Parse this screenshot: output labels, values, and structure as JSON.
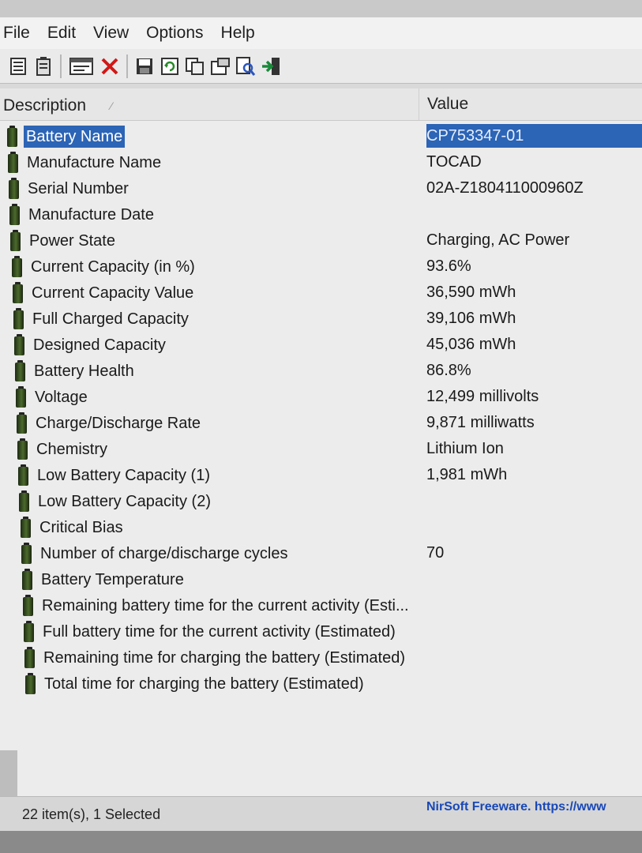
{
  "menu": [
    "File",
    "Edit",
    "View",
    "Options",
    "Help"
  ],
  "toolbar_icons": [
    "html-report-icon",
    "save-icon-small",
    "properties-icon",
    "delete-icon",
    "save-icon",
    "refresh-icon",
    "copy-icon",
    "properties-icon-2",
    "find-icon",
    "exit-icon"
  ],
  "columns": {
    "description": "Description",
    "value": "Value"
  },
  "rows": [
    {
      "description": "Battery Name",
      "value": "CP753347-01",
      "selected": true
    },
    {
      "description": "Manufacture Name",
      "value": "TOCAD"
    },
    {
      "description": "Serial Number",
      "value": "02A-Z180411000960Z"
    },
    {
      "description": "Manufacture Date",
      "value": ""
    },
    {
      "description": "Power State",
      "value": "Charging, AC Power"
    },
    {
      "description": "Current Capacity (in %)",
      "value": "93.6%"
    },
    {
      "description": "Current Capacity Value",
      "value": "36,590 mWh"
    },
    {
      "description": "Full Charged Capacity",
      "value": "39,106 mWh"
    },
    {
      "description": "Designed Capacity",
      "value": "45,036 mWh"
    },
    {
      "description": "Battery Health",
      "value": "86.8%"
    },
    {
      "description": "Voltage",
      "value": "12,499 millivolts"
    },
    {
      "description": "Charge/Discharge Rate",
      "value": "9,871 milliwatts"
    },
    {
      "description": "Chemistry",
      "value": "Lithium Ion"
    },
    {
      "description": "Low Battery Capacity (1)",
      "value": "1,981 mWh"
    },
    {
      "description": "Low Battery Capacity (2)",
      "value": ""
    },
    {
      "description": "Critical Bias",
      "value": ""
    },
    {
      "description": "Number of charge/discharge cycles",
      "value": "70"
    },
    {
      "description": "Battery Temperature",
      "value": ""
    },
    {
      "description": "Remaining battery time for the current activity (Esti...",
      "value": ""
    },
    {
      "description": "Full battery time for the current activity (Estimated)",
      "value": ""
    },
    {
      "description": "Remaining time for charging the battery (Estimated)",
      "value": ""
    },
    {
      "description": "Total  time for charging the battery (Estimated)",
      "value": ""
    }
  ],
  "status": {
    "items": "22 item(s), 1 Selected",
    "link": "NirSoft Freeware. https://www"
  },
  "colors": {
    "selection": "#2c64b6",
    "link": "#1848b8"
  }
}
